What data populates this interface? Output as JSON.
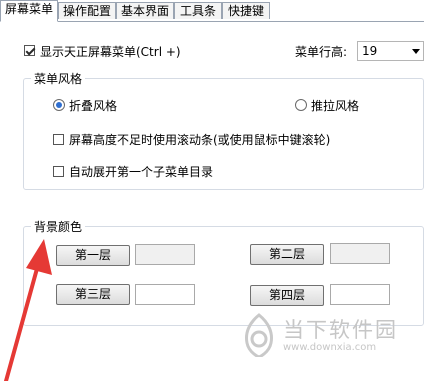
{
  "tabs": [
    {
      "label": "屏幕菜单",
      "active": true
    },
    {
      "label": "操作配置",
      "active": false
    },
    {
      "label": "基本界面",
      "active": false
    },
    {
      "label": "工具条",
      "active": false
    },
    {
      "label": "快捷键",
      "active": false
    }
  ],
  "show_menu_checkbox": {
    "label": "显示天正屏幕菜单(Ctrl +)",
    "checked": true
  },
  "row_height": {
    "label": "菜单行高:",
    "value": "19"
  },
  "menu_style": {
    "title": "菜单风格",
    "fold_label": "折叠风格",
    "pull_label": "推拉风格",
    "selected": "fold",
    "scroll_label": "屏幕高度不足时使用滚动条(或使用鼠标中键滚轮)",
    "scroll_checked": false,
    "expand_label": "自动展开第一个子菜单目录",
    "expand_checked": false
  },
  "background": {
    "title": "背景颜色",
    "layer1_label": "第一层",
    "layer2_label": "第二层",
    "layer3_label": "第三层",
    "layer4_label": "第四层",
    "layer1_color": "#f0f0f0",
    "layer2_color": "#f0f0f0",
    "layer3_color": "#ffffff",
    "layer4_color": "#ffffff"
  },
  "watermark": {
    "text": "当下软件园",
    "url": "www.downxia.com"
  },
  "annotation_color": "#e53935"
}
